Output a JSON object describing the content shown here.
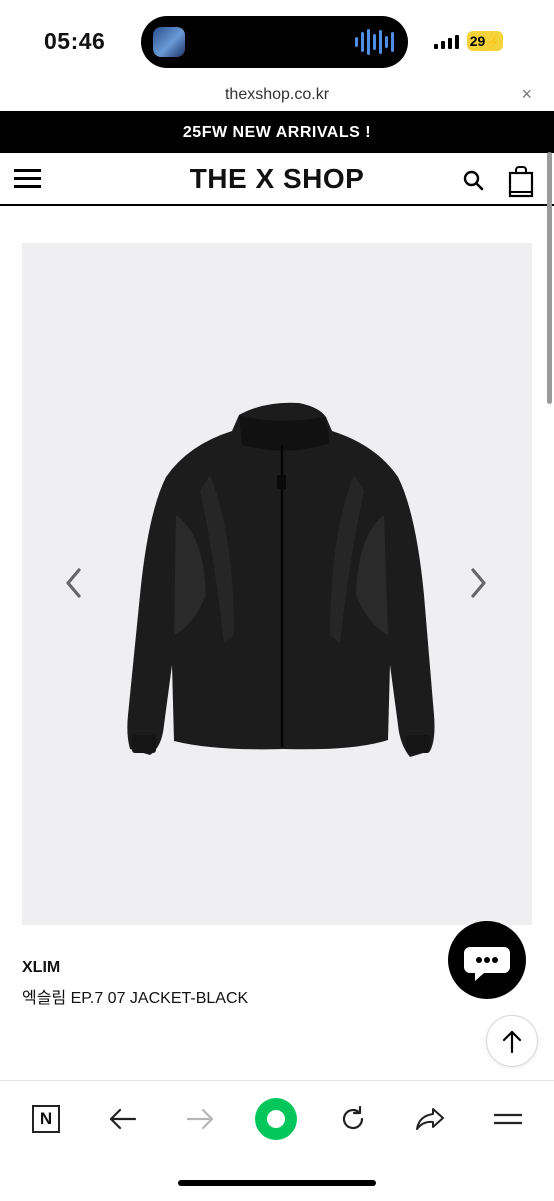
{
  "status_bar": {
    "time": "05:46",
    "battery": "29",
    "battery_color": "#f4d23a"
  },
  "browser": {
    "url": "thexshop.co.kr",
    "close_glyph": "×"
  },
  "banner": {
    "text": "25FW NEW ARRIVALS !"
  },
  "header": {
    "logo": "THE X SHOP",
    "icons": [
      "hamburger-menu-icon",
      "search-icon",
      "shopping-bag-icon"
    ]
  },
  "product": {
    "image_alt": "black zip-up jacket",
    "background_color": "#efeff1",
    "brand": "XLIM",
    "name": "엑슬림 EP.7 07 JACKET-BLACK"
  },
  "floating": {
    "chat_icon": "chat-bubble-icon",
    "top_icon": "arrow-up-icon"
  },
  "toolbar": {
    "items": [
      "naver-n-icon",
      "back-arrow-icon",
      "forward-arrow-icon",
      "green-circle-icon",
      "reload-icon",
      "share-icon",
      "menu-icon"
    ],
    "n_label": "N",
    "accent_color": "#03c75a"
  }
}
